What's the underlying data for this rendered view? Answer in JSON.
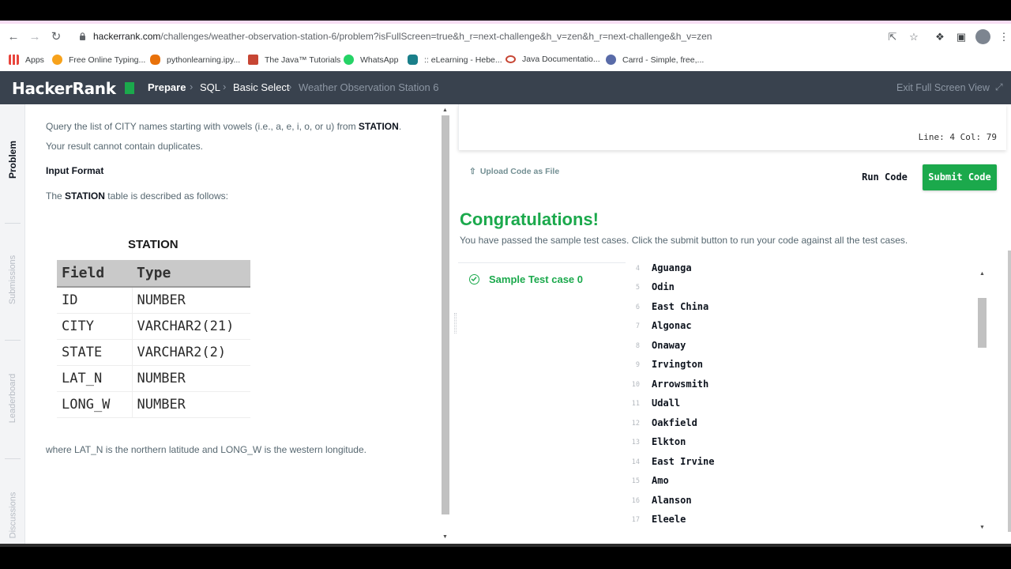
{
  "browser": {
    "url_host": "hackerrank.com",
    "url_path": "/challenges/weather-observation-station-6/problem?isFullScreen=true&h_r=next-challenge&h_v=zen&h_r=next-challenge&h_v=zen",
    "bookmarks": [
      {
        "label": "Apps",
        "icon": "apps-grid-icon",
        "color": "#e8453c"
      },
      {
        "label": "Free Online Typing...",
        "icon": "typing-icon",
        "color": "#f7a21b"
      },
      {
        "label": "pythonlearning.ipy...",
        "icon": "colab-icon",
        "color": "#e8710a"
      },
      {
        "label": "The Java™ Tutorials",
        "icon": "oracle-icon",
        "color": "#c74634"
      },
      {
        "label": "WhatsApp",
        "icon": "whatsapp-icon",
        "color": "#25d366"
      },
      {
        "label": ":: eLearning - Hebe...",
        "icon": "elearning-icon",
        "color": "#1a7f8a"
      },
      {
        "label": "Java Documentatio...",
        "icon": "oracle-ring-icon",
        "color": "#c74634"
      },
      {
        "label": "Carrd - Simple, free,...",
        "icon": "carrd-icon",
        "color": "#596ba8"
      }
    ]
  },
  "header": {
    "logo": "HackerRank",
    "breadcrumb": [
      "Prepare",
      "SQL",
      "Basic Select",
      "Weather Observation Station 6"
    ],
    "exit_label": "Exit Full Screen View"
  },
  "side_tabs": [
    "Problem",
    "Submissions",
    "Leaderboard",
    "Discussions"
  ],
  "problem": {
    "line1_pre": "Query the list of CITY names starting with vowels (i.e., a, e, i, o, or u) from ",
    "line1_bold": "STATION",
    "line1_post": ".",
    "line2": "Your result cannot contain duplicates.",
    "input_format": "Input Format",
    "desc_pre": "The ",
    "desc_bold": "STATION",
    "desc_post": " table is described as follows:",
    "table_title": "STATION",
    "table_headers": [
      "Field",
      "Type"
    ],
    "table_rows": [
      [
        "ID",
        "NUMBER"
      ],
      [
        "CITY",
        "VARCHAR2(21)"
      ],
      [
        "STATE",
        "VARCHAR2(2)"
      ],
      [
        "LAT_N",
        "NUMBER"
      ],
      [
        "LONG_W",
        "NUMBER"
      ]
    ],
    "footer": "where LAT_N is the northern latitude and LONG_W is the western longitude."
  },
  "editor": {
    "status": "Line: 4 Col: 79",
    "upload_label": "Upload Code as File",
    "run_label": "Run Code",
    "submit_label": "Submit Code"
  },
  "result": {
    "title": "Congratulations!",
    "message": "You have passed the sample test cases. Click the submit button to run your code against all the test cases.",
    "test_case": "Sample Test case 0",
    "output_lines": [
      {
        "n": "4",
        "v": "Aguanga"
      },
      {
        "n": "5",
        "v": "Odin"
      },
      {
        "n": "6",
        "v": "East China"
      },
      {
        "n": "7",
        "v": "Algonac"
      },
      {
        "n": "8",
        "v": "Onaway"
      },
      {
        "n": "9",
        "v": "Irvington"
      },
      {
        "n": "10",
        "v": "Arrowsmith"
      },
      {
        "n": "11",
        "v": "Udall"
      },
      {
        "n": "12",
        "v": "Oakfield"
      },
      {
        "n": "13",
        "v": "Elkton"
      },
      {
        "n": "14",
        "v": "East Irvine"
      },
      {
        "n": "15",
        "v": "Amo"
      },
      {
        "n": "16",
        "v": "Alanson"
      },
      {
        "n": "17",
        "v": "Eleele"
      }
    ]
  },
  "colors": {
    "header_bg": "#39424e",
    "brand_green": "#1ba94c"
  }
}
